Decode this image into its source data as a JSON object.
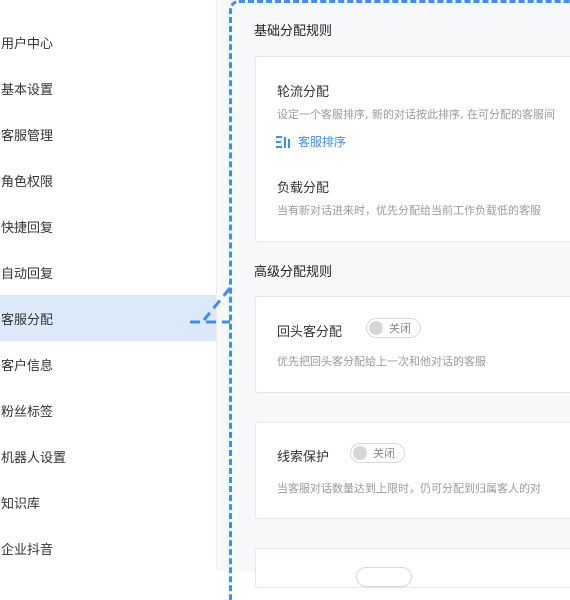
{
  "sidebar": {
    "items": [
      {
        "label": "用户中心"
      },
      {
        "label": "基本设置"
      },
      {
        "label": "客服管理"
      },
      {
        "label": "角色权限"
      },
      {
        "label": "快捷回复"
      },
      {
        "label": "自动回复"
      },
      {
        "label": "客服分配",
        "active": true
      },
      {
        "label": "客户信息"
      },
      {
        "label": "粉丝标签"
      },
      {
        "label": "机器人设置"
      },
      {
        "label": "知识库"
      },
      {
        "label": "企业抖音"
      }
    ]
  },
  "basic": {
    "title": "基础分配规则",
    "round_robin": {
      "title": "轮流分配",
      "desc": "设定一个客服排序, 新的对话按此排序, 在可分配的客服间",
      "link": "客服排序",
      "link_icon": "sort-icon"
    },
    "load": {
      "title": "负载分配",
      "desc": "当有新对话进来时，优先分配给当前工作负载低的客服"
    }
  },
  "advanced": {
    "title": "高级分配规则",
    "returning": {
      "title": "回头客分配",
      "toggle": "关闭",
      "desc": "优先把回头客分配给上一次和他对话的客服"
    },
    "lead": {
      "title": "线索保护",
      "toggle": "关闭",
      "desc": "当客服对话数量达到上限时，仍可分配到归属客人的对"
    }
  },
  "colors": {
    "accent": "#3d8ef0",
    "active_bg": "#dce9fb"
  }
}
